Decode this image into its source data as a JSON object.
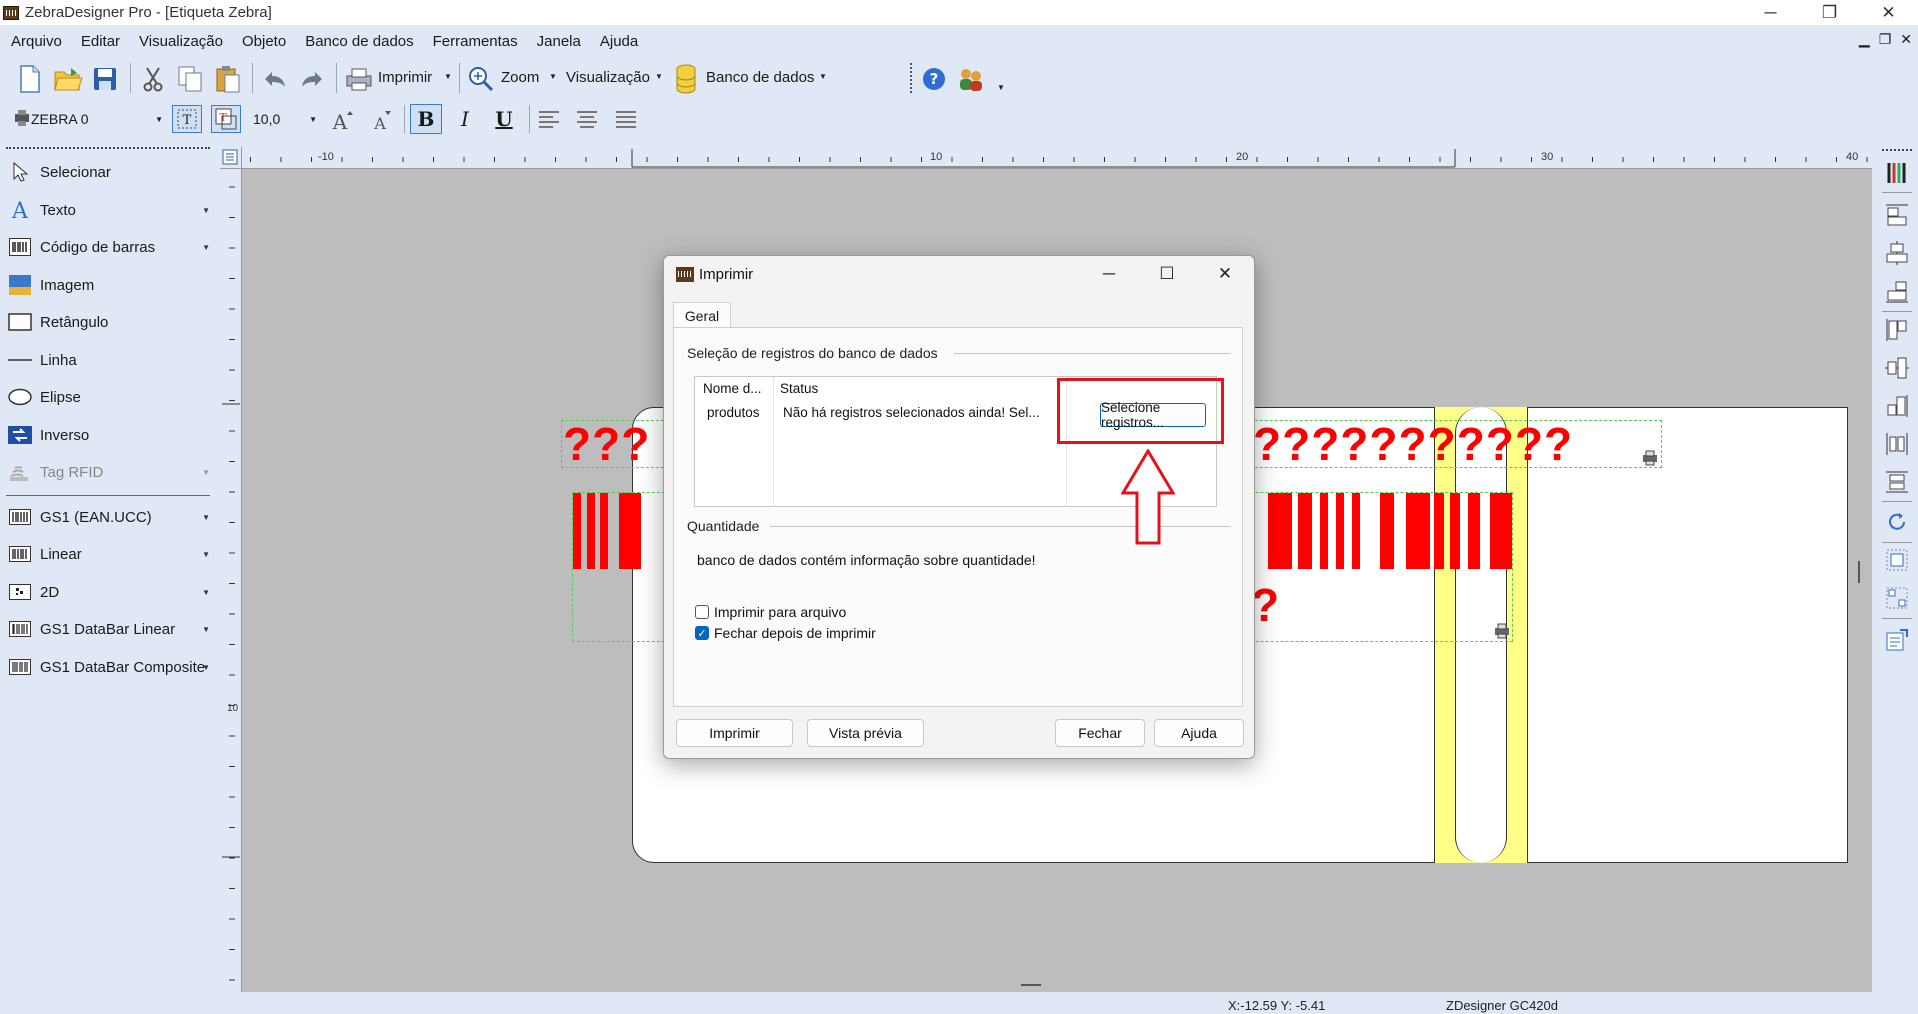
{
  "app": {
    "title": "ZebraDesigner Pro - [Etiqueta Zebra]"
  },
  "window_controls": {
    "minimize": "─",
    "restore": "❐",
    "close": "✕"
  },
  "menu": {
    "items": [
      "Arquivo",
      "Editar",
      "Visualização",
      "Objeto",
      "Banco de dados",
      "Ferramentas",
      "Janela",
      "Ajuda"
    ],
    "mdi_minimize": "▁",
    "mdi_restore": "❐",
    "mdi_close": "✕"
  },
  "toolbar": {
    "print_label": "Imprimir",
    "zoom_label": "Zoom",
    "view_label": "Visualização",
    "database_label": "Banco de dados"
  },
  "format_toolbar": {
    "font_name": "ZEBRA 0",
    "font_size": "10,0",
    "bold": "B",
    "italic": "I",
    "underline": "U"
  },
  "tools": [
    {
      "label": "Selecionar",
      "icon": "pointer-icon",
      "has_arrow": false
    },
    {
      "label": "Texto",
      "icon": "text-icon",
      "has_arrow": true
    },
    {
      "label": "Código de barras",
      "icon": "barcode-icon",
      "has_arrow": true
    },
    {
      "label": "Imagem",
      "icon": "image-icon",
      "has_arrow": false
    },
    {
      "label": "Retângulo",
      "icon": "rectangle-icon",
      "has_arrow": false
    },
    {
      "label": "Linha",
      "icon": "line-icon",
      "has_arrow": false
    },
    {
      "label": "Elipse",
      "icon": "ellipse-icon",
      "has_arrow": false
    },
    {
      "label": "Inverso",
      "icon": "inverse-icon",
      "has_arrow": false
    },
    {
      "label": "Tag RFID",
      "icon": "rfid-icon",
      "has_arrow": true,
      "disabled": true
    }
  ],
  "barcode_tools": [
    {
      "label": "GS1 (EAN.UCC)",
      "icon": "gs1-barcode-icon"
    },
    {
      "label": "Linear",
      "icon": "linear-barcode-icon"
    },
    {
      "label": "2D",
      "icon": "2d-barcode-icon"
    },
    {
      "label": "GS1 DataBar Linear",
      "icon": "databar-linear-icon"
    },
    {
      "label": "GS1 DataBar Composite",
      "icon": "databar-composite-icon"
    }
  ],
  "rulers": {
    "top": [
      "-10",
      "10",
      "20",
      "30",
      "40"
    ],
    "left": [
      "10"
    ]
  },
  "canvas": {
    "placeholder_left": "???",
    "placeholder_right": "???????????",
    "placeholder_single": "?"
  },
  "status": {
    "coords": "X:-12.59 Y: -5.41",
    "printer": "ZDesigner GC420d"
  },
  "dialog": {
    "title": "Imprimir",
    "tab": "Geral",
    "db_group": "Seleção de registros do banco de dados",
    "columns": [
      "Nome d...",
      "Status"
    ],
    "row": {
      "name": "produtos",
      "status": "Não há registros selecionados ainda! Sel...",
      "button": "Selecione registros..."
    },
    "quantity_group": "Quantidade",
    "quantity_info": "banco de dados contém informação sobre quantidade!",
    "print_to_file": "Imprimir para arquivo",
    "print_to_file_checked": false,
    "close_after_print": "Fechar depois de imprimir",
    "close_after_print_checked": true,
    "buttons": {
      "print": "Imprimir",
      "preview": "Vista prévia",
      "close": "Fechar",
      "help": "Ajuda"
    }
  },
  "colors": {
    "accent": "#0067c0",
    "highlight": "#e8101a",
    "placeholder": "#ff0000",
    "label_strip": "#ffff88"
  }
}
